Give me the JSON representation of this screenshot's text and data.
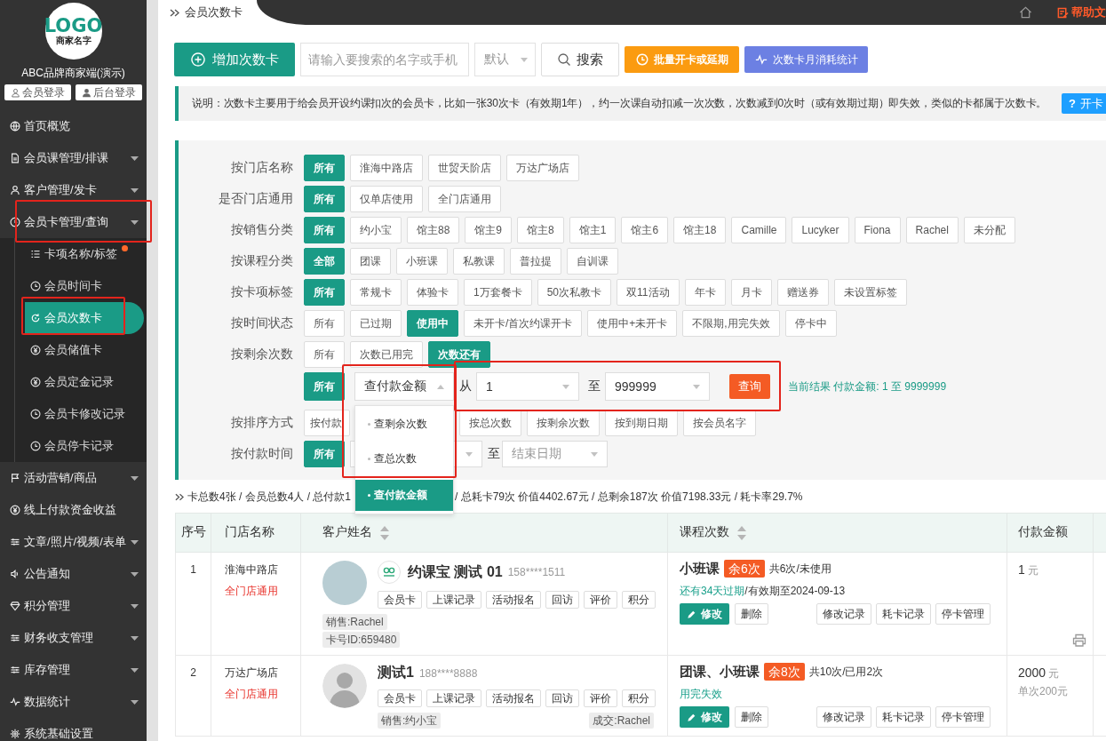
{
  "sidebar": {
    "logo": {
      "title": "LOGO",
      "subtitle": "商家名字"
    },
    "brand": "ABC品牌商家端(演示)",
    "login_buttons": [
      {
        "label": "会员登录",
        "kind": "member"
      },
      {
        "label": "后台登录",
        "kind": "admin"
      }
    ],
    "menu": [
      {
        "label": "首页概览",
        "kind": "link",
        "highlighted": false
      },
      {
        "label": "会员课管理/排课",
        "kind": "group",
        "highlighted": false
      },
      {
        "label": "客户管理/发卡",
        "kind": "group",
        "highlighted": false
      },
      {
        "label": "会员卡管理/查询",
        "kind": "group",
        "expanded": true,
        "highlighted": true,
        "children": [
          {
            "label": "卡项名称/标签",
            "selected": false,
            "dot": true,
            "highlighted": false
          },
          {
            "label": "会员时间卡",
            "selected": false,
            "dot": false,
            "highlighted": false
          },
          {
            "label": "会员次数卡",
            "selected": true,
            "dot": false,
            "highlighted": true
          },
          {
            "label": "会员储值卡",
            "selected": false,
            "dot": false,
            "highlighted": false
          },
          {
            "label": "会员定金记录",
            "selected": false,
            "dot": false,
            "highlighted": false
          },
          {
            "label": "会员卡修改记录",
            "selected": false,
            "dot": false,
            "highlighted": false
          },
          {
            "label": "会员停卡记录",
            "selected": false,
            "dot": false,
            "highlighted": false
          }
        ]
      },
      {
        "label": "活动营销/商品",
        "kind": "group",
        "highlighted": false
      },
      {
        "label": "线上付款资金收益",
        "kind": "link",
        "highlighted": false
      },
      {
        "label": "文章/照片/视频/表单",
        "kind": "group",
        "highlighted": false
      },
      {
        "label": "公告通知",
        "kind": "group",
        "highlighted": false
      },
      {
        "label": "积分管理",
        "kind": "group",
        "highlighted": false
      },
      {
        "label": "财务收支管理",
        "kind": "group",
        "highlighted": false
      },
      {
        "label": "库存管理",
        "kind": "group",
        "highlighted": false
      },
      {
        "label": "数据统计",
        "kind": "group",
        "highlighted": false
      },
      {
        "label": "系统基础设置",
        "kind": "link",
        "highlighted": false
      }
    ]
  },
  "topbar": {
    "breadcrumb": "会员次数卡",
    "help": "帮助文"
  },
  "toolbar": {
    "add_button": "增加次数卡",
    "search": {
      "placeholder": "请输入要搜索的名字或手机"
    },
    "sort_select": {
      "placeholder": "默认"
    },
    "search_button": "搜索",
    "batch_button": "批量开卡或延期",
    "stats_button": "次数卡月消耗统计"
  },
  "notice": {
    "text": "说明：次数卡主要用于给会员开设约课扣次的会员卡，比如一张30次卡（有效期1年），约一次课自动扣减一次次数，次数减到0次时（或有效期过期）即失效，类似的卡都属于次数卡。",
    "help_button": {
      "icon": "?",
      "label": "开卡"
    }
  },
  "filters": [
    {
      "kind": "options",
      "label": "按门店名称",
      "options": [
        {
          "label": "所有",
          "selected": true
        },
        {
          "label": "淮海中路店",
          "selected": false
        },
        {
          "label": "世贸天阶店",
          "selected": false
        },
        {
          "label": "万达广场店",
          "selected": false
        }
      ]
    },
    {
      "kind": "options",
      "label": "是否门店通用",
      "options": [
        {
          "label": "所有",
          "selected": true
        },
        {
          "label": "仅单店使用",
          "selected": false
        },
        {
          "label": "全门店通用",
          "selected": false
        }
      ]
    },
    {
      "kind": "options",
      "label": "按销售分类",
      "options": [
        {
          "label": "所有",
          "selected": true
        },
        {
          "label": "约小宝",
          "selected": false
        },
        {
          "label": "馆主88",
          "selected": false
        },
        {
          "label": "馆主9",
          "selected": false
        },
        {
          "label": "馆主8",
          "selected": false
        },
        {
          "label": "馆主1",
          "selected": false
        },
        {
          "label": "馆主6",
          "selected": false
        },
        {
          "label": "馆主18",
          "selected": false
        },
        {
          "label": "Camille",
          "selected": false
        },
        {
          "label": "Lucyker",
          "selected": false
        },
        {
          "label": "Fiona",
          "selected": false
        },
        {
          "label": "Rachel",
          "selected": false
        },
        {
          "label": "未分配",
          "selected": false
        }
      ]
    },
    {
      "kind": "options",
      "label": "按课程分类",
      "options": [
        {
          "label": "全部",
          "selected": true
        },
        {
          "label": "团课",
          "selected": false
        },
        {
          "label": "小班课",
          "selected": false
        },
        {
          "label": "私教课",
          "selected": false
        },
        {
          "label": "普拉提",
          "selected": false
        },
        {
          "label": "自训课",
          "selected": false
        }
      ]
    },
    {
      "kind": "options",
      "label": "按卡项标签",
      "options": [
        {
          "label": "所有",
          "selected": true
        },
        {
          "label": "常规卡",
          "selected": false
        },
        {
          "label": "体验卡",
          "selected": false
        },
        {
          "label": "1万套餐卡",
          "selected": false
        },
        {
          "label": "50次私教卡",
          "selected": false
        },
        {
          "label": "双11活动",
          "selected": false
        },
        {
          "label": "年卡",
          "selected": false
        },
        {
          "label": "月卡",
          "selected": false
        },
        {
          "label": "赠送券",
          "selected": false
        },
        {
          "label": "未设置标签",
          "selected": false
        }
      ]
    },
    {
      "kind": "options",
      "label": "按时间状态",
      "options": [
        {
          "label": "所有",
          "selected": false
        },
        {
          "label": "已过期",
          "selected": false
        },
        {
          "label": "使用中",
          "selected": true
        },
        {
          "label": "未开卡/首次约课开卡",
          "selected": false
        },
        {
          "label": "使用中+未开卡",
          "selected": false
        },
        {
          "label": "不限期,用完失效",
          "selected": false
        },
        {
          "label": "停卡中",
          "selected": false
        }
      ]
    },
    {
      "kind": "options",
      "label": "按剩余次数",
      "options": [
        {
          "label": "所有",
          "selected": false
        },
        {
          "label": "次数已用完",
          "selected": false
        },
        {
          "label": "次数还有",
          "selected": true
        }
      ]
    },
    {
      "kind": "range",
      "all": {
        "label": "所有",
        "selected": true
      },
      "field_select": {
        "value": "查付款金额",
        "expanded": true,
        "highlighted": true,
        "options": [
          {
            "label": "查剩余次数",
            "selected": false
          },
          {
            "label": "查总次数",
            "selected": false
          },
          {
            "label": "查付款金额",
            "selected": true
          }
        ]
      },
      "from_label": "从",
      "from": {
        "value": "1"
      },
      "to_label": "至",
      "to": {
        "value": "999999"
      },
      "query_button": "查询",
      "range_highlighted": true,
      "result": "当前结果 付款金额: 1 至 9999999"
    },
    {
      "kind": "options",
      "label": "按排序方式",
      "options": [
        {
          "label": "按付款",
          "selected": false,
          "kind": "cut"
        },
        {
          "label": "按总次数",
          "selected": false,
          "kind": "full"
        },
        {
          "label": "按剩余次数",
          "selected": false,
          "kind": "full"
        },
        {
          "label": "按到期日期",
          "selected": false,
          "kind": "full"
        },
        {
          "label": "按会员名字",
          "selected": false,
          "kind": "full"
        }
      ]
    },
    {
      "kind": "dates",
      "label": "按付款时间",
      "all": {
        "label": "所有",
        "selected": true
      },
      "to_label": "至",
      "end": {
        "placeholder": "结束日期"
      }
    }
  ],
  "summary": [
    "卡总数4张 / 会员总数4人 / 总付款1",
    "/ 总耗卡79次 价值4402.67元 / 总剩余187次 价值7198.33元 / 耗卡率29.7%"
  ],
  "table": {
    "columns": [
      {
        "label": "序号",
        "sortable": false
      },
      {
        "label": "门店名称",
        "sortable": false
      },
      {
        "label": "客户姓名",
        "sortable": true
      },
      {
        "label": "课程次数",
        "sortable": true
      },
      {
        "label": "付款金额",
        "sortable": false
      }
    ],
    "rows": [
      {
        "index": "1",
        "store": "淮海中路店",
        "scope": "全门店通用",
        "customer": {
          "avatar": {
            "kind": "photo"
          },
          "app_logo": true,
          "name": "约课宝 测试 01",
          "phone": "158****1511",
          "actions": [
            "会员卡",
            "上课记录",
            "活动报名",
            "回访",
            "评价",
            "积分"
          ],
          "tags": [
            {
              "kind": "sales",
              "text": "销售:Rachel"
            },
            {
              "kind": "id",
              "text": "卡号ID:659480"
            }
          ]
        },
        "course": {
          "name": "小班课",
          "remaining": "余6次",
          "usage": "共6次/未使用",
          "status": "还有34天过期",
          "expiry": "/有效期至2024-09-13",
          "edit_button": "修改",
          "delete_button": "删除",
          "record_buttons": [
            "修改记录",
            "耗卡记录",
            "停卡管理"
          ]
        },
        "amount": {
          "value": "1",
          "unit": "元"
        },
        "printable": true
      },
      {
        "index": "2",
        "store": "万达广场店",
        "scope": "全门店通用",
        "customer": {
          "avatar": {
            "kind": "default"
          },
          "app_logo": false,
          "name": "测试1",
          "phone": "188****8888",
          "actions": [
            "会员卡",
            "上课记录",
            "活动报名",
            "回访",
            "评价",
            "积分"
          ],
          "tags": [
            {
              "kind": "sales",
              "text": "销售:约小宝"
            },
            {
              "kind": "deal",
              "text": "成交:Rachel"
            }
          ]
        },
        "course": {
          "name": "团课、小班课",
          "remaining": "余8次",
          "usage": "共10次/已用2次",
          "status": "用完失效",
          "edit_button": "修改",
          "delete_button": "删除",
          "record_buttons": [
            "修改记录",
            "耗卡记录",
            "停卡管理"
          ]
        },
        "amount": {
          "value": "2000",
          "unit": "元",
          "note": "单次200元"
        },
        "printable": false
      }
    ]
  }
}
